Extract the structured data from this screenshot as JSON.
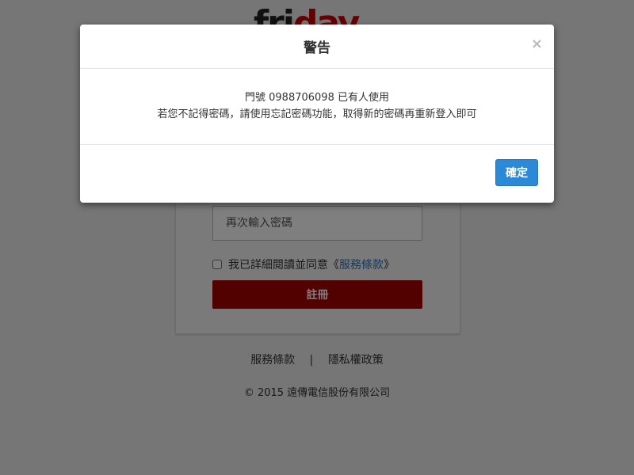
{
  "brand": {
    "logo_text_a": "fri",
    "logo_text_b": "day"
  },
  "form": {
    "confirm_password_placeholder": "再次輸入密碼",
    "terms_prefix": "我已詳細閱讀並同意《",
    "terms_link": "服務條款",
    "terms_suffix": "》",
    "register_label": "註冊"
  },
  "footer": {
    "terms_link": "服務條款",
    "separator": "|",
    "privacy_link": "隱私權政策",
    "copyright": "© 2015 遠傳電信股份有限公司"
  },
  "modal": {
    "title": "警告",
    "close_symbol": "×",
    "message_line1": "門號 0988706098 已有人使用",
    "message_line2": "若您不記得密碼，請使用忘記密碼功能，取得新的密碼再重新登入即可",
    "ok_label": "確定"
  },
  "colors": {
    "register_button": "#a40000",
    "ok_button": "#2b8ad8",
    "link": "#2a6fb5"
  }
}
